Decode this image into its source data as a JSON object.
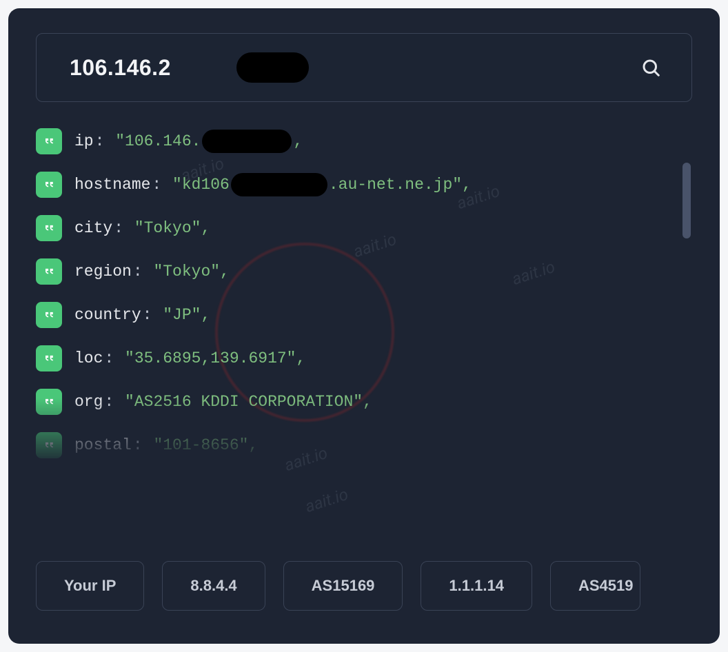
{
  "watermark": "aait.io",
  "search": {
    "value": "106.146.2",
    "placeholder": ""
  },
  "results": [
    {
      "key": "ip",
      "pre": "\"106.146.",
      "redact": "ip",
      "post": ","
    },
    {
      "key": "hostname",
      "pre": "\"kd106",
      "redact": "host",
      "post": ".au-net.ne.jp\","
    },
    {
      "key": "city",
      "pre": "\"Tokyo\",",
      "redact": null,
      "post": ""
    },
    {
      "key": "region",
      "pre": "\"Tokyo\",",
      "redact": null,
      "post": ""
    },
    {
      "key": "country",
      "pre": "\"JP\",",
      "redact": null,
      "post": ""
    },
    {
      "key": "loc",
      "pre": "\"35.6895,139.6917\",",
      "redact": null,
      "post": ""
    },
    {
      "key": "org",
      "pre": "\"AS2516 KDDI CORPORATION\",",
      "redact": null,
      "post": ""
    },
    {
      "key": "postal",
      "pre": "\"101-8656\",",
      "redact": null,
      "post": ""
    }
  ],
  "suggestions": [
    "Your IP",
    "8.8.4.4",
    "AS15169",
    "1.1.1.14",
    "AS4519"
  ]
}
